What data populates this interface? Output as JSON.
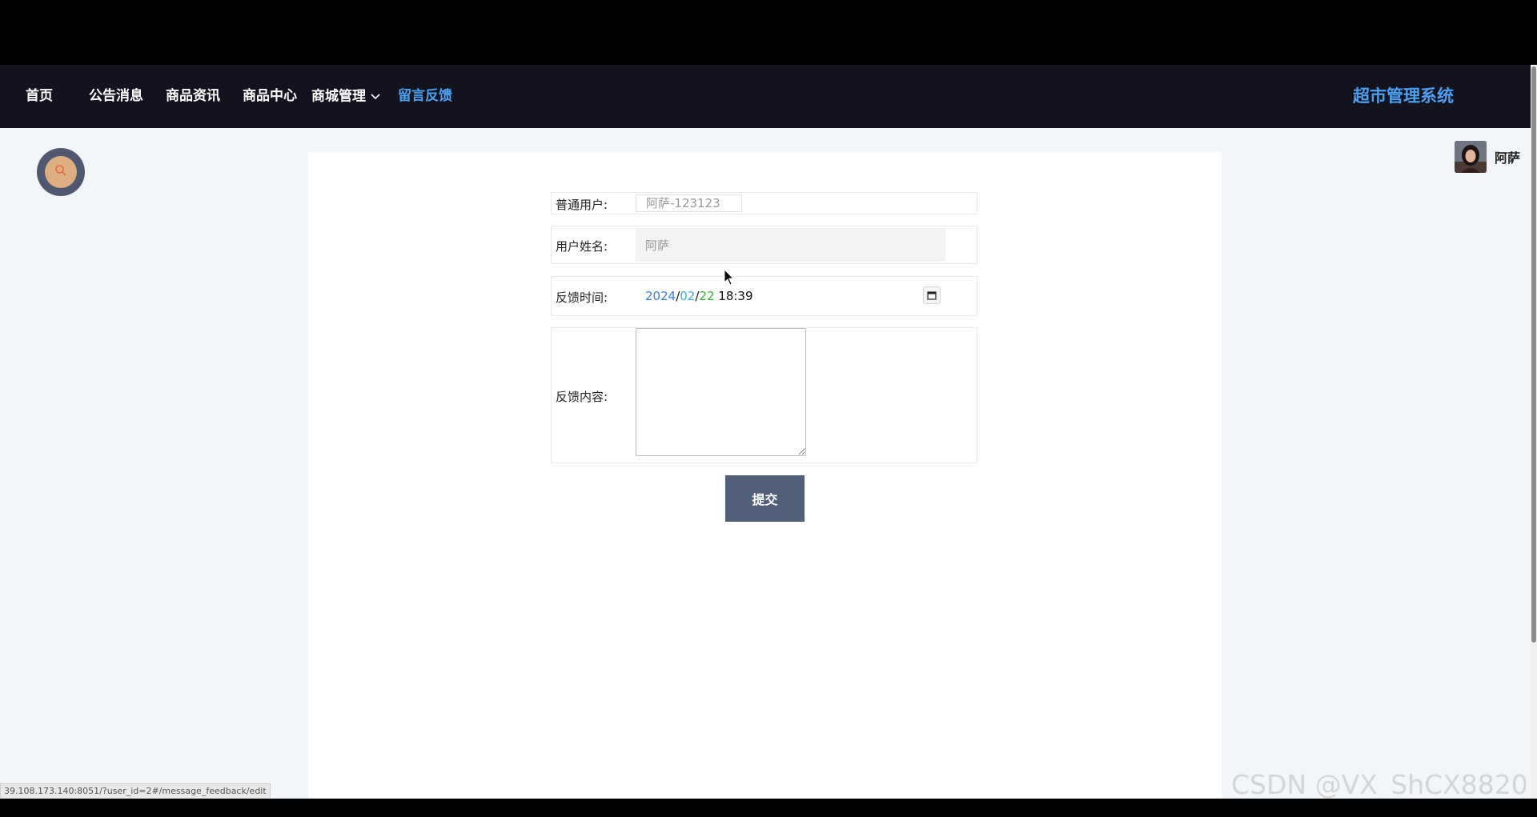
{
  "nav": {
    "items": [
      {
        "label": "首页"
      },
      {
        "label": "公告消息"
      },
      {
        "label": "商品资讯"
      },
      {
        "label": "商品中心"
      },
      {
        "label": "商城管理",
        "has_dropdown": true
      },
      {
        "label": "留言反馈",
        "active": true
      }
    ],
    "brand": "超市管理系统"
  },
  "user": {
    "name": "阿萨"
  },
  "form": {
    "user_label": "普通用户:",
    "user_value": "阿萨-123123",
    "name_label": "用户姓名:",
    "name_value": "阿萨",
    "time_label": "反馈时间:",
    "time_year": "2024",
    "time_month": "02",
    "time_day": "22",
    "time_clock": "18:39",
    "content_label": "反馈内容:",
    "content_value": "",
    "submit_label": "提交"
  },
  "status_url": "39.108.173.140:8051/?user_id=2#/message_feedback/edit",
  "watermark": "CSDN @VX_ShCX8820",
  "colors": {
    "nav_bg": "#12131f",
    "active_accent": "#4ca0f2",
    "submit_bg": "#525f78",
    "search_outer": "#4f5870",
    "search_inner": "#dcae82",
    "page_bg": "#f3f6f8"
  },
  "icons": {
    "search": "search-icon",
    "dropdown": "chevron-down-icon",
    "calendar": "calendar-icon"
  }
}
